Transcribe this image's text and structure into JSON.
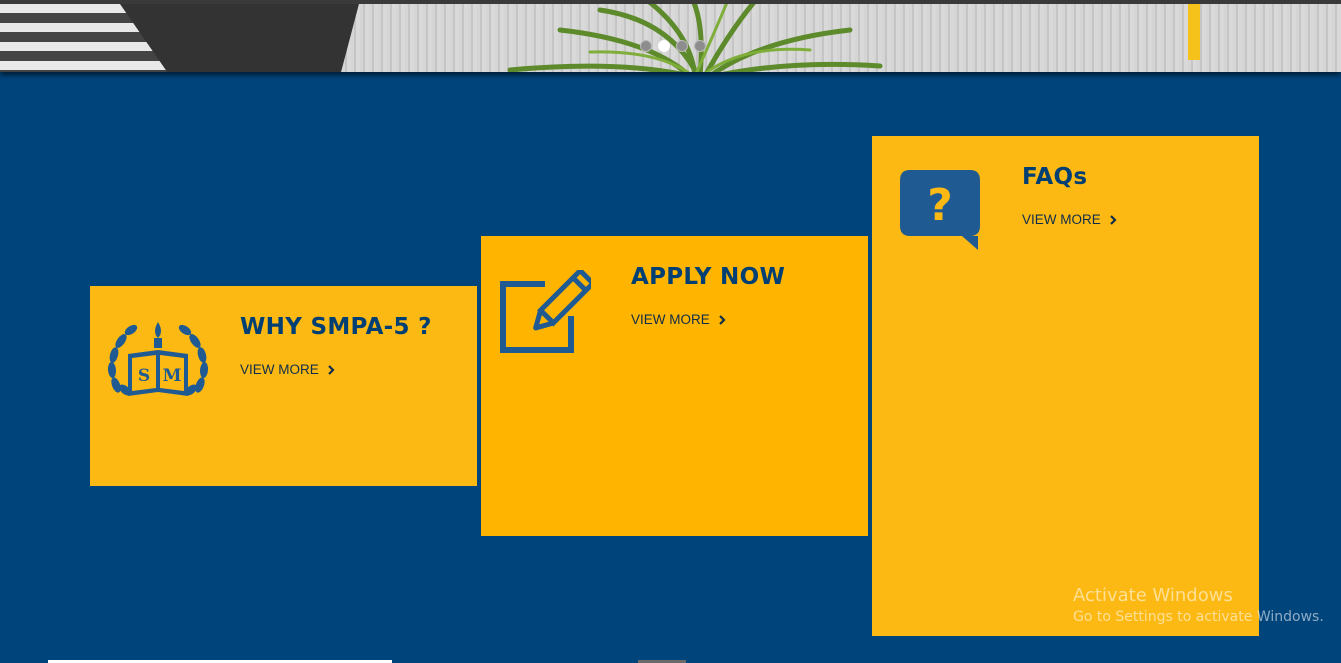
{
  "banner": {
    "slides": 4,
    "active_slide": 2
  },
  "cards": [
    {
      "title": "WHY SMPA-5 ?",
      "link": "VIEW MORE",
      "icon": "school-crest-icon"
    },
    {
      "title": "APPLY NOW",
      "link": "VIEW MORE",
      "icon": "edit-pencil-icon"
    },
    {
      "title": "FAQs",
      "link": "VIEW MORE",
      "icon": "question-bubble-icon"
    }
  ],
  "crest": {
    "letters_left": "S",
    "letters_right": "M"
  },
  "watermark": {
    "line1": "Activate Windows",
    "line2": "Go to Settings to activate Windows."
  },
  "colors": {
    "background": "#00447c",
    "card": "#fdb913",
    "text": "#003f73"
  }
}
